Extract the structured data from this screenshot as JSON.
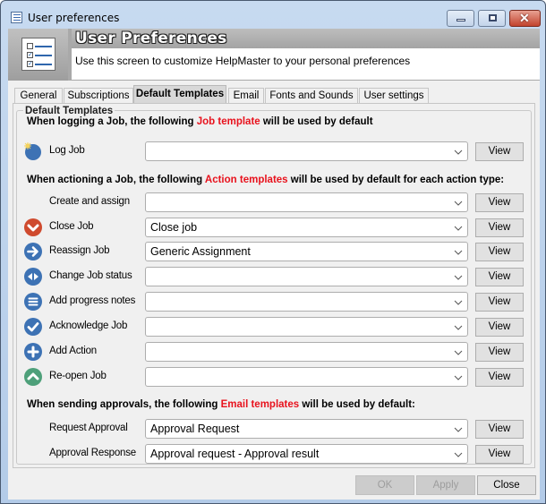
{
  "window": {
    "title": "User preferences",
    "icon": "list-window-icon",
    "controls": [
      "minimize",
      "maximize",
      "close"
    ]
  },
  "header": {
    "title": "User Preferences",
    "description": "Use this screen to customize HelpMaster to your personal preferences",
    "icon": "checklist-icon"
  },
  "tabs": [
    {
      "label": "General",
      "active": false
    },
    {
      "label": "Subscriptions",
      "active": false
    },
    {
      "label": "Default Templates",
      "active": true
    },
    {
      "label": "Email",
      "active": false
    },
    {
      "label": "Fonts and Sounds",
      "active": false
    },
    {
      "label": "User settings",
      "active": false
    }
  ],
  "group": {
    "legend": "Default Templates"
  },
  "job_section": {
    "prefix": "When logging a Job, the following ",
    "highlight": "Job template",
    "suffix": " will be used by default",
    "highlight_color": "#e8121d",
    "rows": [
      {
        "label": "Log Job",
        "icon": "log-job-icon",
        "value": "",
        "view_label": "View"
      }
    ]
  },
  "action_section": {
    "prefix": "When actioning a Job, the following ",
    "highlight": "Action templates",
    "suffix": " will be used by default for each action type:",
    "rows": [
      {
        "label": "Create and assign",
        "icon": "",
        "value": "",
        "view_label": "View"
      },
      {
        "label": "Close Job",
        "icon": "close-job-icon",
        "value": "Close job",
        "view_label": "View"
      },
      {
        "label": "Reassign Job",
        "icon": "reassign-arrow-icon",
        "value": "Generic Assignment",
        "view_label": "View"
      },
      {
        "label": "Change Job status",
        "icon": "change-status-icon",
        "value": "",
        "view_label": "View"
      },
      {
        "label": "Add progress notes",
        "icon": "progress-notes-icon",
        "value": "",
        "view_label": "View"
      },
      {
        "label": "Acknowledge Job",
        "icon": "acknowledge-check-icon",
        "value": "",
        "view_label": "View"
      },
      {
        "label": "Add Action",
        "icon": "add-plus-icon",
        "value": "",
        "view_label": "View"
      },
      {
        "label": "Re-open Job",
        "icon": "reopen-chevron-up-icon",
        "value": "",
        "view_label": "View"
      }
    ]
  },
  "email_section": {
    "prefix": "When sending approvals, the following ",
    "highlight": "Email templates",
    "suffix": " will be used by default:",
    "rows": [
      {
        "label": "Request Approval",
        "value": "Approval Request",
        "view_label": "View"
      },
      {
        "label": "Approval Response",
        "value": "Approval request - Approval result",
        "view_label": "View"
      }
    ]
  },
  "footer": {
    "ok_label": "OK",
    "ok_enabled": false,
    "apply_label": "Apply",
    "apply_enabled": false,
    "close_label": "Close"
  },
  "colors": {
    "blue_icon": "#3d72b4",
    "red_icon": "#cf4a2e",
    "green_icon": "#4ea07a",
    "highlight": "#e8121d"
  }
}
